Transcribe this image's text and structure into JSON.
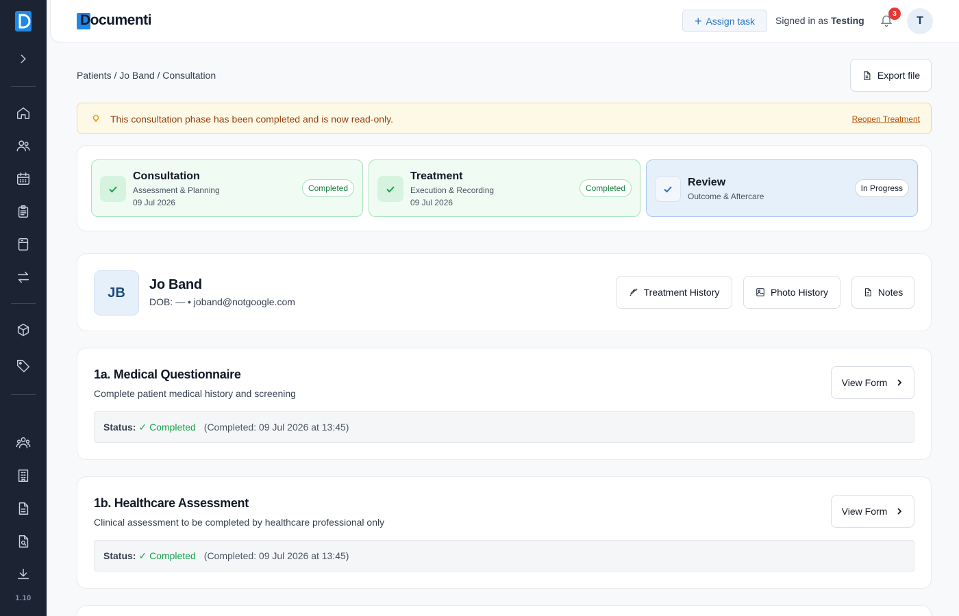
{
  "sidebar": {
    "version": "1.10"
  },
  "topbar": {
    "brand": "Documenti",
    "assign_label": "Assign task",
    "signed_prefix": "Signed in as",
    "signed_user": "Testing",
    "notification_count": "3",
    "avatar_initial": "T"
  },
  "breadcrumb": "Patients / Jo Band / Consultation",
  "export_label": "Export file",
  "alert": {
    "icon": "lightbulb-icon",
    "text": "This consultation phase has been completed and is now read-only.",
    "link": "Reopen Treatment"
  },
  "phases": [
    {
      "title": "Consultation",
      "subtitle": "Assessment & Planning",
      "date": "09 Jul 2026",
      "badge": "Completed"
    },
    {
      "title": "Treatment",
      "subtitle": "Execution & Recording",
      "date": "09 Jul 2026",
      "badge": "Completed"
    },
    {
      "title": "Review",
      "subtitle": "Outcome & Aftercare",
      "badge": "In Progress"
    }
  ],
  "patient": {
    "initials": "JB",
    "name": "Jo Band",
    "meta": "DOB: — • joband@notgoogle.com",
    "buttons": {
      "treatment_history": "Treatment History",
      "photo_history": "Photo History",
      "notes": "Notes"
    }
  },
  "forms": [
    {
      "title": "1a. Medical Questionnaire",
      "description": "Complete patient medical history and screening",
      "button": "View Form",
      "status_label": "Status:",
      "status_value": "✓ Completed",
      "completed_at": "(Completed: 09 Jul 2026 at 13:45)"
    },
    {
      "title": "1b. Healthcare Assessment",
      "description": "Clinical assessment to be completed by healthcare professional only",
      "button": "View Form",
      "status_label": "Status:",
      "status_value": "✓ Completed",
      "completed_at": "(Completed: 09 Jul 2026 at 13:45)"
    }
  ],
  "colors": {
    "sidebar": "#1c2434",
    "accent": "#1e88e5",
    "success": "#16a34a",
    "warning_bg": "#fef9e7"
  }
}
